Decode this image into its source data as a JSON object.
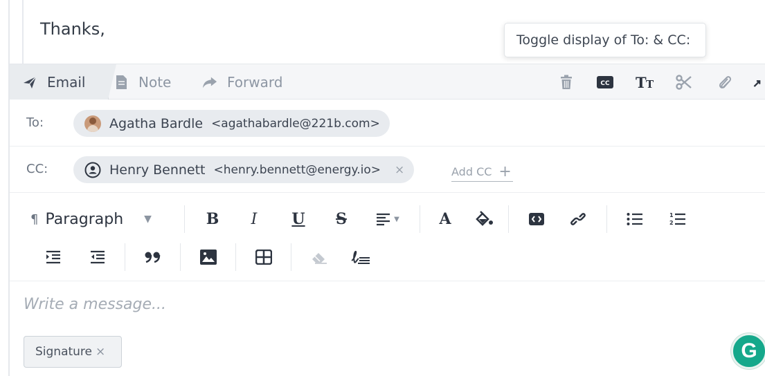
{
  "previous_message": {
    "text": "Thanks,"
  },
  "tooltip": {
    "text": "Toggle display of To: & CC:"
  },
  "tabs": [
    {
      "label": "Email",
      "icon": "paper-plane-icon",
      "active": true
    },
    {
      "label": "Note",
      "icon": "note-icon",
      "active": false
    },
    {
      "label": "Forward",
      "icon": "forward-arrow-icon",
      "active": false
    }
  ],
  "tab_tools": [
    "trash-icon",
    "cc-icon",
    "text-size-icon",
    "scissors-icon",
    "paperclip-icon",
    "expand-icon"
  ],
  "to": {
    "label": "To:",
    "recipient": {
      "name": "Agatha Bardle",
      "email": "<agathabardle@221b.com>"
    }
  },
  "cc": {
    "label": "CC:",
    "recipient": {
      "name": "Henry Bennett",
      "email": "<henry.bennett@energy.io>",
      "remove": "×"
    },
    "add_label": "Add CC",
    "add_symbol": "+"
  },
  "toolbar": {
    "paragraph_mark": "¶",
    "paragraph_label": "Paragraph",
    "bold": "B",
    "italic": "I",
    "underline": "U",
    "strike": "S",
    "font_color": "A"
  },
  "message": {
    "placeholder": "Write a message..."
  },
  "signature": {
    "label": "Signature",
    "remove": "×"
  },
  "grammarly": {
    "letter": "G"
  },
  "colors": {
    "accent_green": "#15a88b",
    "chip_bg": "#e8ebef",
    "tab_bg": "#f5f6f8"
  }
}
